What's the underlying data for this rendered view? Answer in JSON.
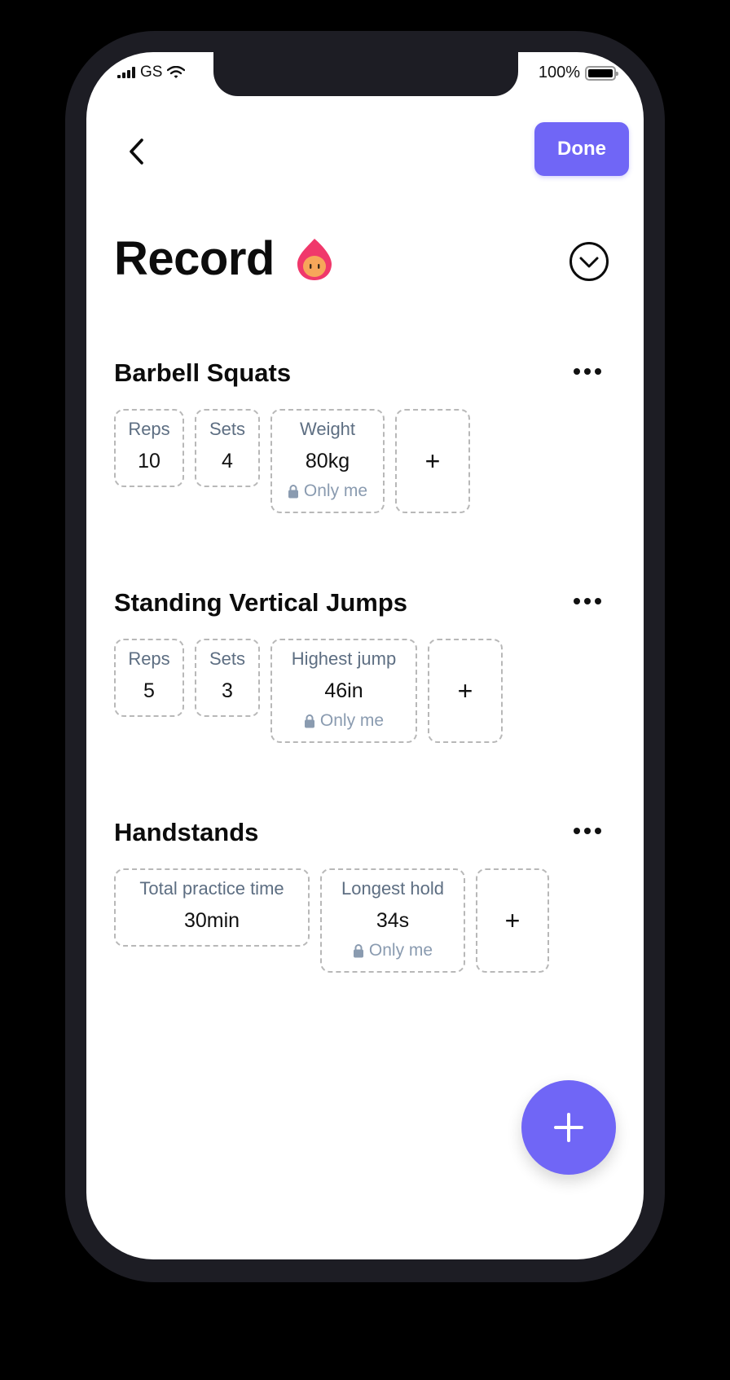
{
  "status_bar": {
    "carrier": "GS",
    "battery": "100%"
  },
  "header": {
    "back_icon": "chevron-left-icon",
    "done_label": "Done"
  },
  "page": {
    "title": "Record",
    "title_emoji": "flame-character-icon",
    "collapse_icon": "chevron-down-circle-icon"
  },
  "exercises": [
    {
      "name": "Barbell Squats",
      "metrics": [
        {
          "label": "Reps",
          "value": "10"
        },
        {
          "label": "Sets",
          "value": "4"
        },
        {
          "label": "Weight",
          "value": "80kg",
          "privacy": "Only me"
        }
      ],
      "add_label": "+"
    },
    {
      "name": "Standing Vertical Jumps",
      "metrics": [
        {
          "label": "Reps",
          "value": "5"
        },
        {
          "label": "Sets",
          "value": "3"
        },
        {
          "label": "Highest jump",
          "value": "46in",
          "privacy": "Only me"
        }
      ],
      "add_label": "+"
    },
    {
      "name": "Handstands",
      "metrics": [
        {
          "label": "Total practice time",
          "value": "30min"
        },
        {
          "label": "Longest hold",
          "value": "34s",
          "privacy": "Only me"
        }
      ],
      "add_label": "+"
    }
  ],
  "fab": {
    "icon": "plus-icon"
  },
  "colors": {
    "accent": "#7066f6",
    "label": "#5d6e82",
    "privacy": "#8a9bb0",
    "flame_outer": "#f0386b",
    "flame_inner": "#f7a65a"
  }
}
